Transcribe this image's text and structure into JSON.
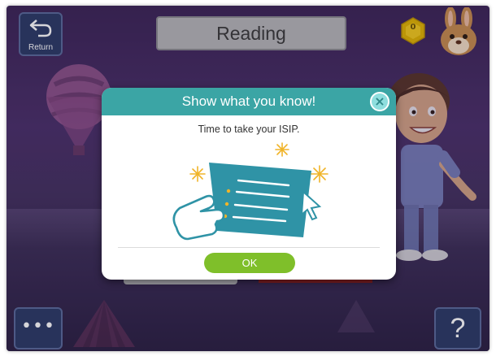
{
  "header": {
    "return_icon": "return-arrow-icon",
    "return_label": "Return",
    "title": "Reading",
    "coin_icon": "hexagon-coin-icon",
    "coin_count": "0",
    "avatar_icon": "bunny-avatar-icon"
  },
  "footer": {
    "more_icon": "ellipsis-icon",
    "more_label": "•••",
    "help_icon": "question-icon",
    "help_label": "?"
  },
  "modal": {
    "title": "Show what you know!",
    "close_icon": "close-icon",
    "close_label": "×",
    "message": "Time to take your ISIP.",
    "illustration": "hand-tapping-checklist-illustration",
    "ok_label": "OK"
  },
  "colors": {
    "modal_header": "#3ba5a5",
    "ok_button": "#7fbf2a",
    "nav_button": "#2b3a66",
    "title_bar": "#b5b5b8"
  }
}
